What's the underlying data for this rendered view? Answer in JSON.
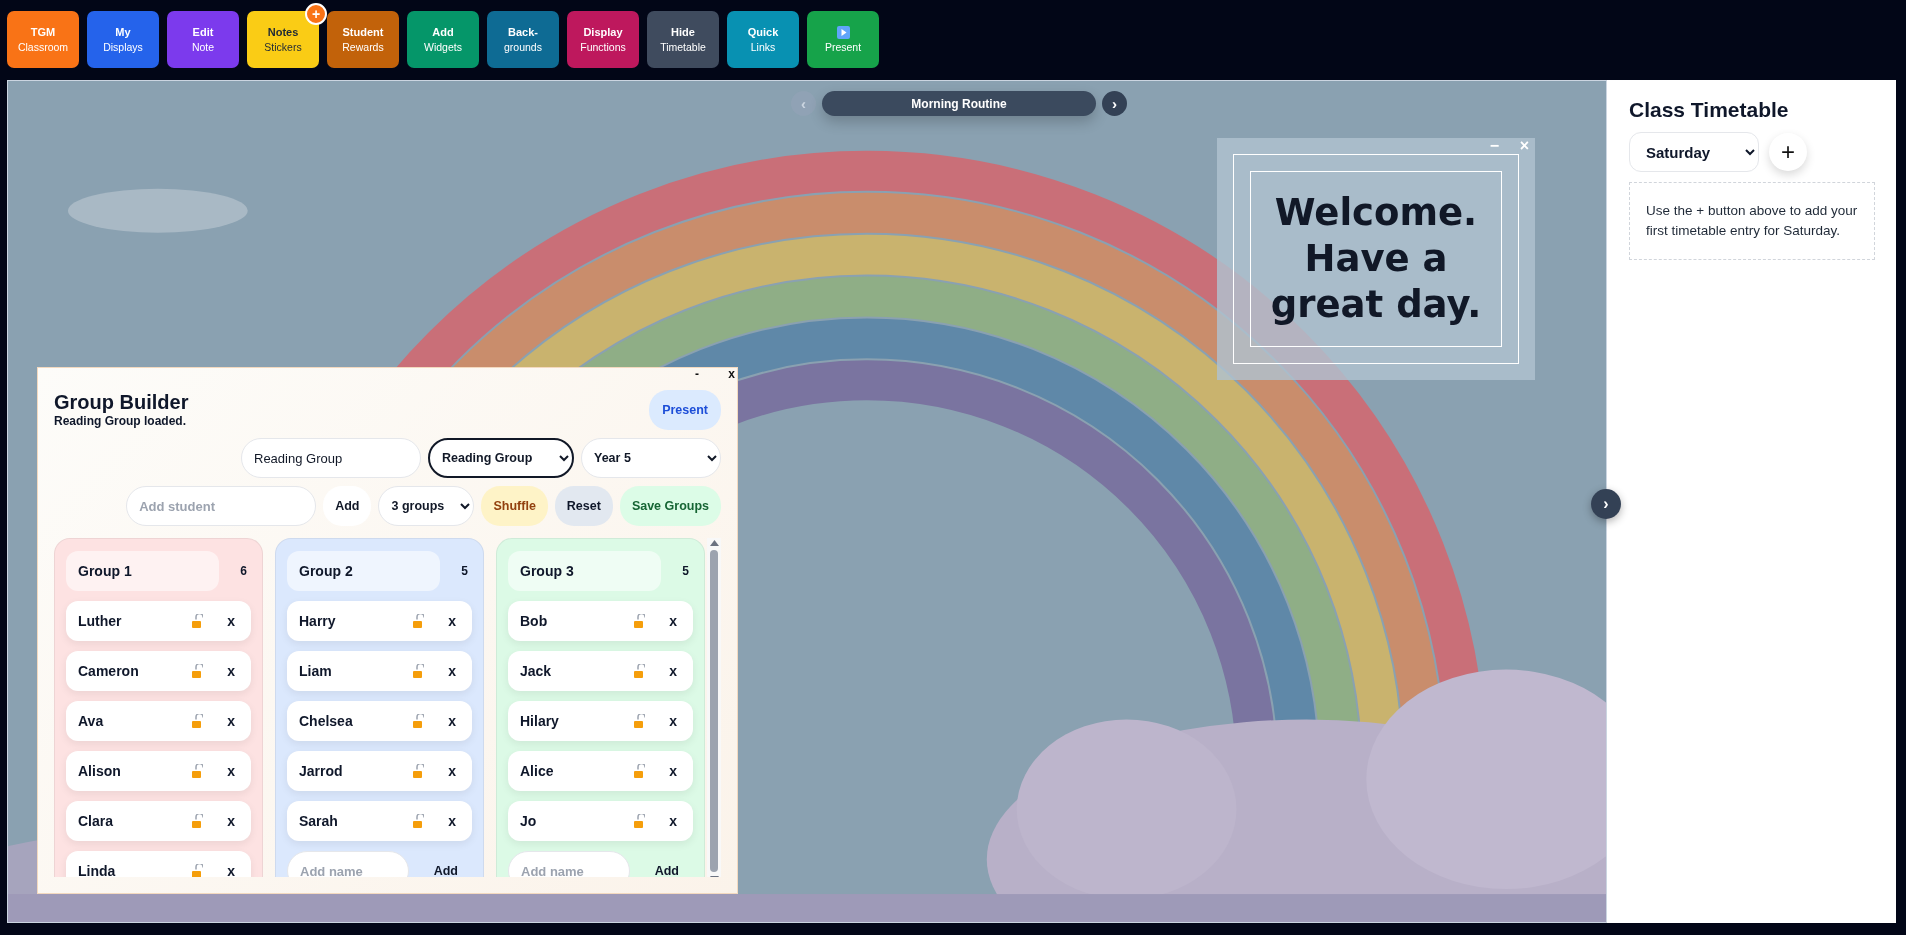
{
  "toolbar": {
    "buttons": [
      {
        "kind": "text",
        "title": "TGM",
        "subtitle": "Classroom",
        "color": "#f97316"
      },
      {
        "kind": "text",
        "title": "My",
        "subtitle": "Displays",
        "color": "#2563eb"
      },
      {
        "kind": "text",
        "title": "Edit",
        "subtitle": "Note",
        "color": "#7c3aed"
      },
      {
        "kind": "text",
        "title": "Notes",
        "subtitle": "Stickers",
        "color": "#facc15",
        "badge": "+"
      },
      {
        "kind": "text",
        "title": "Student",
        "subtitle": "Rewards",
        "color": "#c2620a"
      },
      {
        "kind": "text",
        "title": "Add",
        "subtitle": "Widgets",
        "color": "#059669"
      },
      {
        "kind": "text",
        "title": "Back-",
        "subtitle": "grounds",
        "color": "#0e6b94"
      },
      {
        "kind": "text",
        "title": "Display",
        "subtitle": "Functions",
        "color": "#be185d"
      },
      {
        "kind": "text",
        "title": "Hide",
        "subtitle": "Timetable",
        "color": "#3f4b5e"
      },
      {
        "kind": "text",
        "title": "Quick",
        "subtitle": "Links",
        "color": "#0891b2"
      },
      {
        "kind": "present",
        "subtitle": "Present",
        "color": "#16a34a"
      }
    ]
  },
  "routine_nav": {
    "prev": "‹",
    "prev_disabled": true,
    "title": "Morning Routine",
    "next": "›"
  },
  "welcome_widget": {
    "minimize": "−",
    "close": "×",
    "message": "Welcome. Have a great day."
  },
  "stage_next": "›",
  "group_builder": {
    "minimize": "-",
    "close": "x",
    "title": "Group Builder",
    "status": "Reading Group loaded.",
    "present": "Present",
    "name_field": {
      "value": "Reading Group"
    },
    "group_select": {
      "value": "Reading Group",
      "focused": true
    },
    "year_select": {
      "value": "Year 5",
      "focused": false
    },
    "student_field": {
      "placeholder": "Add student"
    },
    "add": "Add",
    "count_select": {
      "value": "3 groups",
      "focused": false
    },
    "shuffle": "Shuffle",
    "reset": "Reset",
    "save": "Save Groups",
    "groups": [
      {
        "name": "Group 1",
        "count": "6",
        "color": "#fde2e2",
        "students": [
          {
            "name": "Luther",
            "locked": false,
            "remove": "x"
          },
          {
            "name": "Cameron",
            "locked": false,
            "remove": "x"
          },
          {
            "name": "Ava",
            "locked": false,
            "remove": "x"
          },
          {
            "name": "Alison",
            "locked": false,
            "remove": "x"
          },
          {
            "name": "Clara",
            "locked": false,
            "remove": "x"
          },
          {
            "name": "Linda",
            "locked": false,
            "remove": "x"
          }
        ]
      },
      {
        "name": "Group 2",
        "count": "5",
        "color": "#dbe8fd",
        "students": [
          {
            "name": "Harry",
            "locked": false,
            "remove": "x"
          },
          {
            "name": "Liam",
            "locked": false,
            "remove": "x"
          },
          {
            "name": "Chelsea",
            "locked": false,
            "remove": "x"
          },
          {
            "name": "Jarrod",
            "locked": false,
            "remove": "x"
          },
          {
            "name": "Sarah",
            "locked": false,
            "remove": "x"
          }
        ],
        "add_row": {
          "placeholder": "Add name",
          "button": "Add"
        }
      },
      {
        "name": "Group 3",
        "count": "5",
        "color": "#dcfae6",
        "students": [
          {
            "name": "Bob",
            "locked": false,
            "remove": "x"
          },
          {
            "name": "Jack",
            "locked": false,
            "remove": "x"
          },
          {
            "name": "Hilary",
            "locked": false,
            "remove": "x"
          },
          {
            "name": "Alice",
            "locked": false,
            "remove": "x"
          },
          {
            "name": "Jo",
            "locked": false,
            "remove": "x"
          }
        ],
        "add_row": {
          "placeholder": "Add name",
          "button": "Add"
        }
      }
    ]
  },
  "timetable": {
    "title": "Class Timetable",
    "day_select": {
      "value": "Saturday"
    },
    "add": "+",
    "hint": "Use the + button above to add your first timetable entry for Saturday."
  }
}
